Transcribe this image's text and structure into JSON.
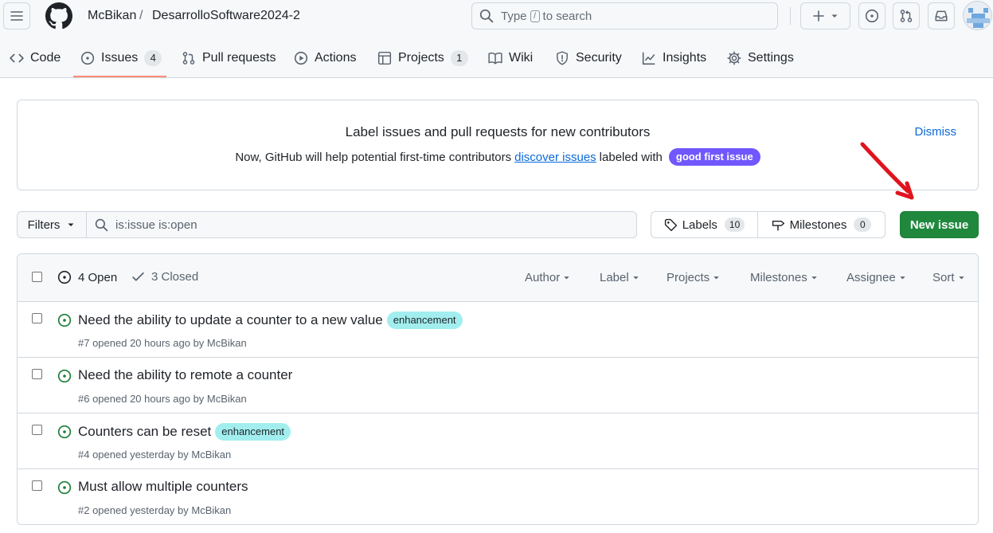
{
  "header": {
    "owner": "McBikan",
    "separator": "/",
    "repo": "DesarrolloSoftware2024-2",
    "search": {
      "prefix": "Type",
      "key": "/",
      "suffix": "to search"
    },
    "icons": [
      "menu-icon",
      "github-logo-icon",
      "search-icon",
      "plus-icon",
      "triangle-down-icon",
      "issue-opened-icon",
      "git-pull-request-icon",
      "inbox-icon"
    ]
  },
  "tabs": [
    {
      "label": "Code",
      "icon": "code-icon"
    },
    {
      "label": "Issues",
      "icon": "issue-opened-icon",
      "count": "4",
      "selected": true
    },
    {
      "label": "Pull requests",
      "icon": "git-pull-request-icon"
    },
    {
      "label": "Actions",
      "icon": "play-icon"
    },
    {
      "label": "Projects",
      "icon": "table-icon",
      "count": "1"
    },
    {
      "label": "Wiki",
      "icon": "book-icon"
    },
    {
      "label": "Security",
      "icon": "shield-icon"
    },
    {
      "label": "Insights",
      "icon": "graph-icon"
    },
    {
      "label": "Settings",
      "icon": "gear-icon"
    }
  ],
  "banner": {
    "title": "Label issues and pull requests for new contributors",
    "text_before": "Now, GitHub will help potential first-time contributors",
    "link": "discover issues",
    "text_after": "labeled with",
    "label": "good first issue",
    "label_color": "#7057ff",
    "dismiss": "Dismiss"
  },
  "toolbar": {
    "filters_label": "Filters",
    "query": "is:issue is:open",
    "labels_label": "Labels",
    "labels_count": "10",
    "milestones_label": "Milestones",
    "milestones_count": "0",
    "new_issue_label": "New issue",
    "new_issue_color": "#1f883d"
  },
  "list_header": {
    "open_label": "4 Open",
    "closed_label": "3 Closed",
    "sorts": [
      "Author",
      "Label",
      "Projects",
      "Milestones",
      "Assignee",
      "Sort"
    ]
  },
  "issues": [
    {
      "title": "Need the ability to update a counter to a new value",
      "label": "enhancement",
      "meta": "#7 opened 20 hours ago by McBikan"
    },
    {
      "title": "Need the ability to remote a counter",
      "label": "",
      "meta": "#6 opened 20 hours ago by McBikan"
    },
    {
      "title": "Counters can be reset",
      "label": "enhancement",
      "meta": "#4 opened yesterday by McBikan"
    },
    {
      "title": "Must allow multiple counters",
      "label": "",
      "meta": "#2 opened yesterday by McBikan"
    }
  ],
  "colors": {
    "open_icon": "#1a7f37",
    "enhancement_label": "#a2eeef",
    "link": "#0969da",
    "tab_underline": "#fd8c73",
    "annotation_arrow": "#e0141e"
  }
}
